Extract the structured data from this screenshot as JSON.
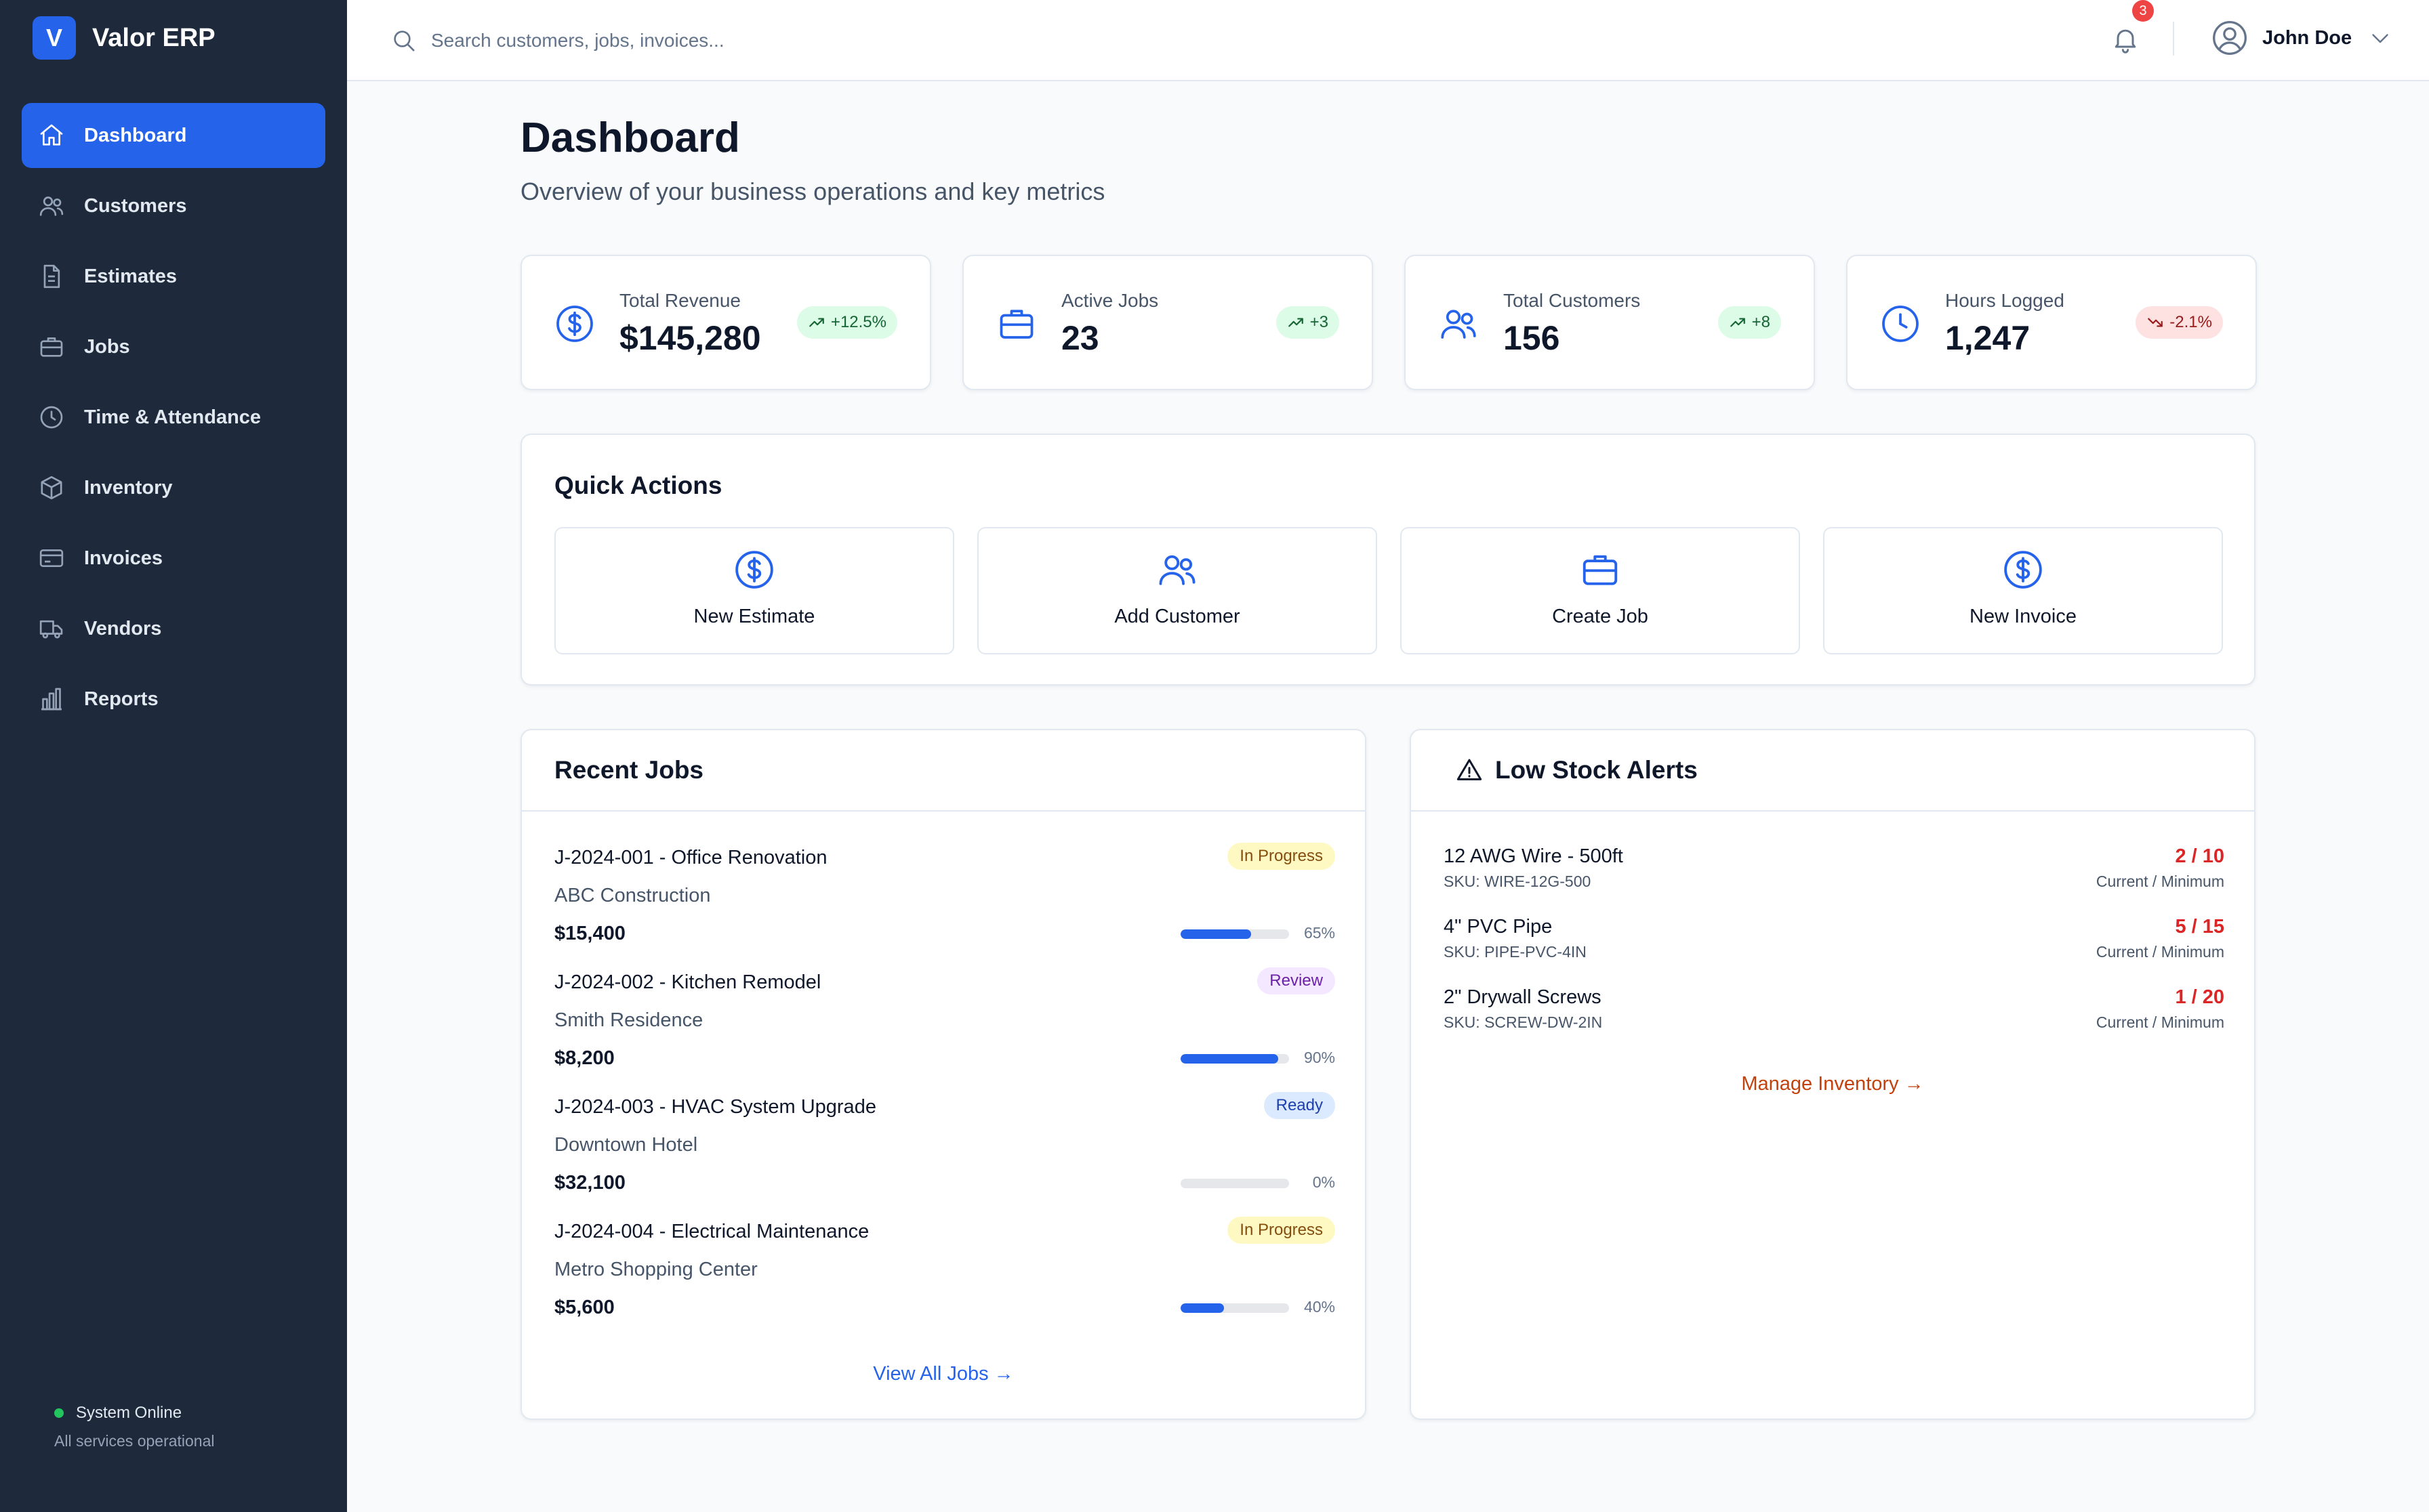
{
  "app": {
    "logo_letter": "V",
    "name": "Valor ERP"
  },
  "sidebar": {
    "items": [
      {
        "label": "Dashboard",
        "icon": "home-icon",
        "active": true
      },
      {
        "label": "Customers",
        "icon": "users-icon"
      },
      {
        "label": "Estimates",
        "icon": "file-icon"
      },
      {
        "label": "Jobs",
        "icon": "briefcase-icon"
      },
      {
        "label": "Time & Attendance",
        "icon": "clock-icon"
      },
      {
        "label": "Inventory",
        "icon": "box-icon"
      },
      {
        "label": "Invoices",
        "icon": "credit-card-icon"
      },
      {
        "label": "Vendors",
        "icon": "truck-icon"
      },
      {
        "label": "Reports",
        "icon": "bar-chart-icon"
      }
    ],
    "status": {
      "label": "System Online",
      "sub": "All services operational"
    }
  },
  "topbar": {
    "search_placeholder": "Search customers, jobs, invoices...",
    "notifications_count": "3",
    "user_name": "John Doe"
  },
  "page": {
    "title": "Dashboard",
    "subtitle": "Overview of your business operations and key metrics"
  },
  "stats": [
    {
      "label": "Total Revenue",
      "value": "$145,280",
      "change": "+12.5%",
      "trend": "up",
      "icon": "dollar-icon"
    },
    {
      "label": "Active Jobs",
      "value": "23",
      "change": "+3",
      "trend": "up",
      "icon": "briefcase-icon"
    },
    {
      "label": "Total Customers",
      "value": "156",
      "change": "+8",
      "trend": "up",
      "icon": "users-icon"
    },
    {
      "label": "Hours Logged",
      "value": "1,247",
      "change": "-2.1%",
      "trend": "down",
      "icon": "clock-icon"
    }
  ],
  "quick_actions": {
    "title": "Quick Actions",
    "items": [
      {
        "label": "New Estimate",
        "icon": "dollar-icon"
      },
      {
        "label": "Add Customer",
        "icon": "users-icon"
      },
      {
        "label": "Create Job",
        "icon": "briefcase-icon"
      },
      {
        "label": "New Invoice",
        "icon": "dollar-icon"
      }
    ]
  },
  "recent_jobs": {
    "title": "Recent Jobs",
    "items": [
      {
        "title": "J-2024-001 - Office Renovation",
        "client": "ABC Construction",
        "amount": "$15,400",
        "status": "In Progress",
        "progress": 65,
        "progress_label": "65%"
      },
      {
        "title": "J-2024-002 - Kitchen Remodel",
        "client": "Smith Residence",
        "amount": "$8,200",
        "status": "Review",
        "progress": 90,
        "progress_label": "90%"
      },
      {
        "title": "J-2024-003 - HVAC System Upgrade",
        "client": "Downtown Hotel",
        "amount": "$32,100",
        "status": "Ready",
        "progress": 0,
        "progress_label": "0%"
      },
      {
        "title": "J-2024-004 - Electrical Maintenance",
        "client": "Metro Shopping Center",
        "amount": "$5,600",
        "status": "In Progress",
        "progress": 40,
        "progress_label": "40%"
      }
    ],
    "view_all": "View All Jobs →"
  },
  "low_stock": {
    "title": "Low Stock Alerts",
    "items": [
      {
        "name": "12 AWG Wire - 500ft",
        "sku": "SKU: WIRE-12G-500",
        "qty": "2 / 10",
        "note": "Current / Minimum"
      },
      {
        "name": "4\" PVC Pipe",
        "sku": "SKU: PIPE-PVC-4IN",
        "qty": "5 / 15",
        "note": "Current / Minimum"
      },
      {
        "name": "2\" Drywall Screws",
        "sku": "SKU: SCREW-DW-2IN",
        "qty": "1 / 20",
        "note": "Current / Minimum"
      }
    ],
    "manage_link": "Manage Inventory →"
  },
  "colors": {
    "sidebar_bg": "#1e293b",
    "accent": "#2563eb",
    "danger": "#dc2626",
    "warning": "#ea580c",
    "success": "#22c55e"
  }
}
